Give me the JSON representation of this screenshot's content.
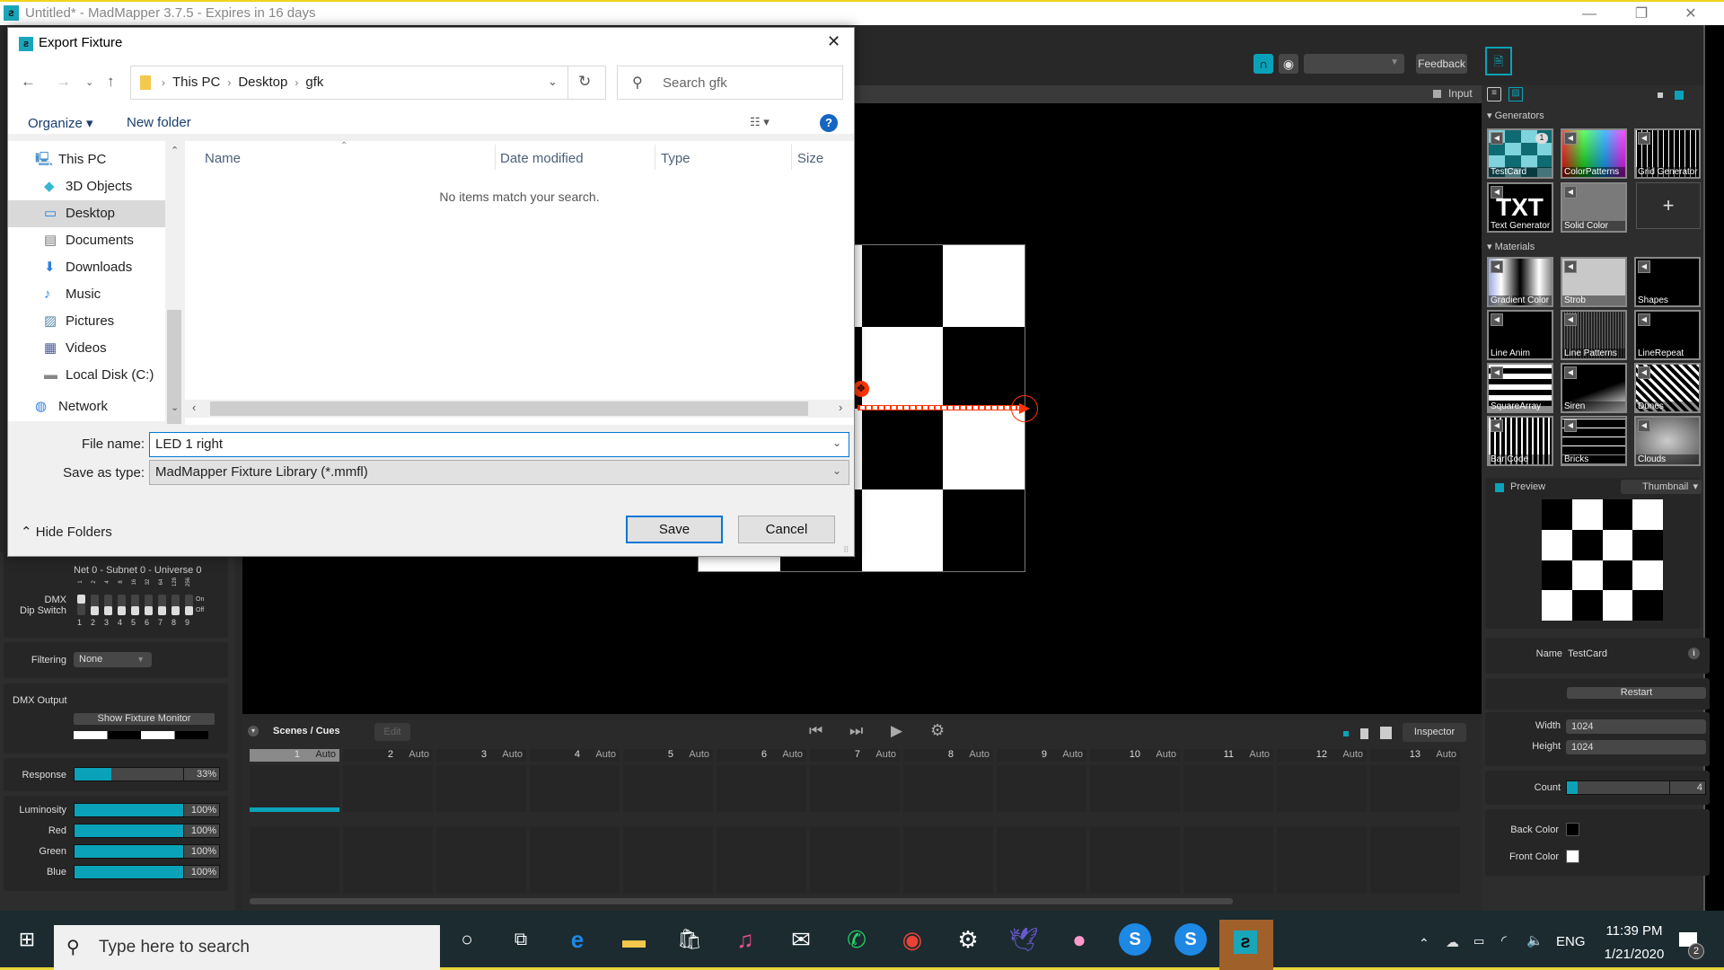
{
  "window": {
    "title": "Untitled* - MadMapper 3.7.5 - Expires in 16 days",
    "minimize_label": "—",
    "maximize_label": "❐",
    "close_label": "✕"
  },
  "toolbar": {
    "feedback_label": "Feedback",
    "input_label": "Input",
    "output_dropdown_value": ""
  },
  "dialog": {
    "title": "Export Fixture",
    "close_label": "✕",
    "breadcrumb": [
      "This PC",
      "Desktop",
      "gfk"
    ],
    "search_placeholder": "Search gfk",
    "organize_label": "Organize ▾",
    "new_folder_label": "New folder",
    "help_label": "?",
    "nav_items": [
      {
        "label": "This PC",
        "icon": "computer-icon"
      },
      {
        "label": "3D Objects",
        "icon": "cube-icon"
      },
      {
        "label": "Desktop",
        "icon": "desktop-icon",
        "selected": true
      },
      {
        "label": "Documents",
        "icon": "document-icon"
      },
      {
        "label": "Downloads",
        "icon": "download-icon"
      },
      {
        "label": "Music",
        "icon": "music-icon"
      },
      {
        "label": "Pictures",
        "icon": "pictures-icon"
      },
      {
        "label": "Videos",
        "icon": "videos-icon"
      },
      {
        "label": "Local Disk (C:)",
        "icon": "disk-icon"
      },
      {
        "label": "Network",
        "icon": "network-icon"
      }
    ],
    "columns": [
      "Name",
      "Date modified",
      "Type",
      "Size"
    ],
    "empty_message": "No items match your search.",
    "file_name_label": "File name:",
    "file_name_value": "LED 1 right",
    "save_type_label": "Save as type:",
    "save_type_value": "MadMapper Fixture Library (*.mmfl)",
    "hide_folders_label": "Hide Folders",
    "save_label": "Save",
    "cancel_label": "Cancel"
  },
  "left_panel": {
    "universe_text": "Net 0 - Subnet 0 - Universe 0",
    "dmx_label": "DMX",
    "dip_switch_label": "Dip Switch",
    "dip_values": [
      "1",
      "2",
      "4",
      "8",
      "16",
      "32",
      "64",
      "128",
      "256"
    ],
    "dip_numbers": [
      "1",
      "2",
      "3",
      "4",
      "5",
      "6",
      "7",
      "8",
      "9"
    ],
    "dip_states": [
      true,
      false,
      false,
      false,
      false,
      false,
      false,
      false,
      false
    ],
    "on_label": "On",
    "off_label": "Off",
    "filtering_label": "Filtering",
    "filtering_value": "None",
    "dmx_output_label": "DMX Output",
    "show_fixture_monitor_label": "Show Fixture Monitor",
    "response_label": "Response",
    "response_value": "33%",
    "response_fraction": 0.33,
    "channels": [
      {
        "label": "Luminosity",
        "value": "100%",
        "fraction": 1.0
      },
      {
        "label": "Red",
        "value": "100%",
        "fraction": 1.0
      },
      {
        "label": "Green",
        "value": "100%",
        "fraction": 1.0
      },
      {
        "label": "Blue",
        "value": "100%",
        "fraction": 1.0
      }
    ]
  },
  "right_panel": {
    "generators_label": "Generators",
    "generators": [
      {
        "label": "TestCard",
        "badge": "1"
      },
      {
        "label": "ColorPatterns"
      },
      {
        "label": "Grid Generator"
      },
      {
        "label": "Text Generator"
      },
      {
        "label": "Solid Color"
      }
    ],
    "add_label": "+",
    "materials_label": "Materials",
    "materials": [
      {
        "label": "Gradient Color"
      },
      {
        "label": "Strob"
      },
      {
        "label": "Shapes"
      },
      {
        "label": "Line Anim"
      },
      {
        "label": "Line Patterns"
      },
      {
        "label": "LineRepeat"
      },
      {
        "label": "SquareArray"
      },
      {
        "label": "Siren"
      },
      {
        "label": "Dunes"
      },
      {
        "label": "Bar Code"
      },
      {
        "label": "Bricks"
      },
      {
        "label": "Clouds"
      }
    ],
    "preview_label": "Preview",
    "preview_mode": "Thumbnail",
    "name_label": "Name",
    "name_value": "TestCard",
    "restart_label": "Restart",
    "width_label": "Width",
    "width_value": "1024",
    "height_label": "Height",
    "height_value": "1024",
    "count_label": "Count",
    "count_value": "4",
    "back_color_label": "Back Color",
    "back_color": "#000000",
    "front_color_label": "Front Color",
    "front_color": "#ffffff"
  },
  "scenes": {
    "title": "Scenes / Cues",
    "edit_label": "Edit",
    "inspector_label": "Inspector",
    "cues": [
      {
        "n": "1",
        "mode": "Auto",
        "active": true
      },
      {
        "n": "2",
        "mode": "Auto"
      },
      {
        "n": "3",
        "mode": "Auto"
      },
      {
        "n": "4",
        "mode": "Auto"
      },
      {
        "n": "5",
        "mode": "Auto"
      },
      {
        "n": "6",
        "mode": "Auto"
      },
      {
        "n": "7",
        "mode": "Auto"
      },
      {
        "n": "8",
        "mode": "Auto"
      },
      {
        "n": "9",
        "mode": "Auto"
      },
      {
        "n": "10",
        "mode": "Auto"
      },
      {
        "n": "11",
        "mode": "Auto"
      },
      {
        "n": "12",
        "mode": "Auto"
      },
      {
        "n": "13",
        "mode": "Auto"
      }
    ]
  },
  "taskbar": {
    "search_placeholder": "Type here to search",
    "language": "ENG",
    "time": "11:39 PM",
    "date": "1/21/2020",
    "notification_count": "2"
  },
  "colors": {
    "accent": "#0aa2b8",
    "dialog_focus": "#0078d7",
    "arrow": "#ff3300"
  }
}
